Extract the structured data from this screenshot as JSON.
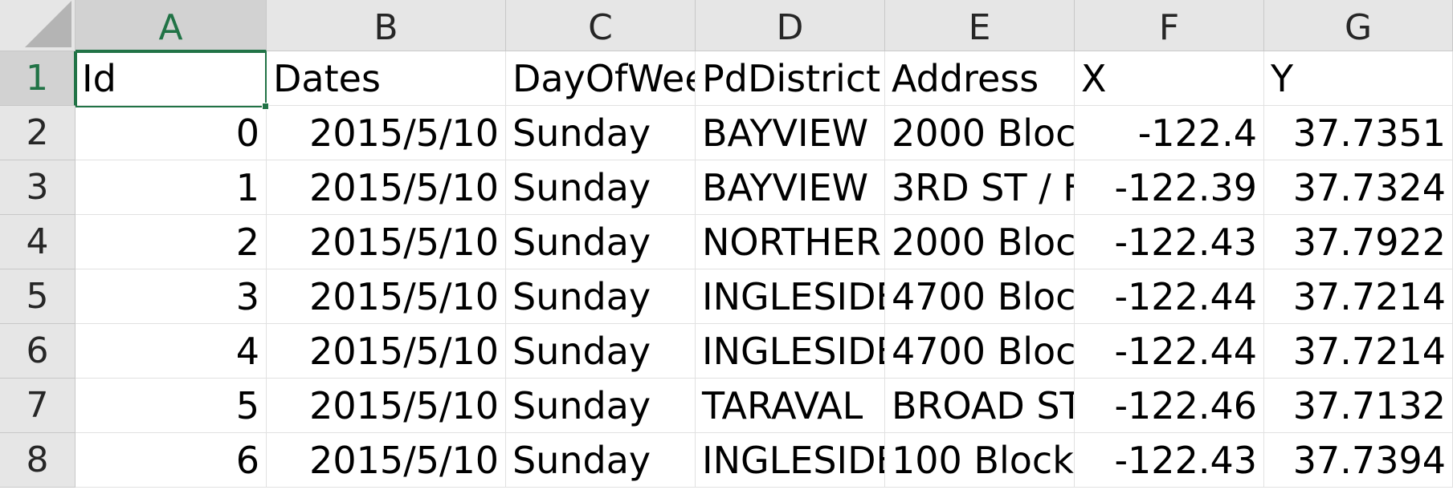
{
  "columns": [
    "A",
    "B",
    "C",
    "D",
    "E",
    "F",
    "G"
  ],
  "row_numbers": [
    "1",
    "2",
    "3",
    "4",
    "5",
    "6",
    "7",
    "8"
  ],
  "active_cell": "A1",
  "rows": [
    [
      "Id",
      "Dates",
      "DayOfWeek",
      "PdDistrict",
      "Address",
      "X",
      "Y"
    ],
    [
      "0",
      "2015/5/10",
      "Sunday",
      "BAYVIEW",
      "2000 Bloc",
      "-122.4",
      "37.7351"
    ],
    [
      "1",
      "2015/5/10",
      "Sunday",
      "BAYVIEW",
      "3RD ST / F",
      "-122.39",
      "37.7324"
    ],
    [
      "2",
      "2015/5/10",
      "Sunday",
      "NORTHERN",
      "2000 Bloc",
      "-122.43",
      "37.7922"
    ],
    [
      "3",
      "2015/5/10",
      "Sunday",
      "INGLESIDE",
      "4700 Bloc",
      "-122.44",
      "37.7214"
    ],
    [
      "4",
      "2015/5/10",
      "Sunday",
      "INGLESIDE",
      "4700 Bloc",
      "-122.44",
      "37.7214"
    ],
    [
      "5",
      "2015/5/10",
      "Sunday",
      "TARAVAL",
      "BROAD ST",
      "-122.46",
      "37.7132"
    ],
    [
      "6",
      "2015/5/10",
      "Sunday",
      "INGLESIDE",
      "100 Block",
      "-122.43",
      "37.7394"
    ]
  ],
  "colors": {
    "accent": "#217346",
    "header_bg": "#e6e6e6",
    "header_selected_bg": "#d2d2d2",
    "gridline": "#e1e1e1"
  }
}
